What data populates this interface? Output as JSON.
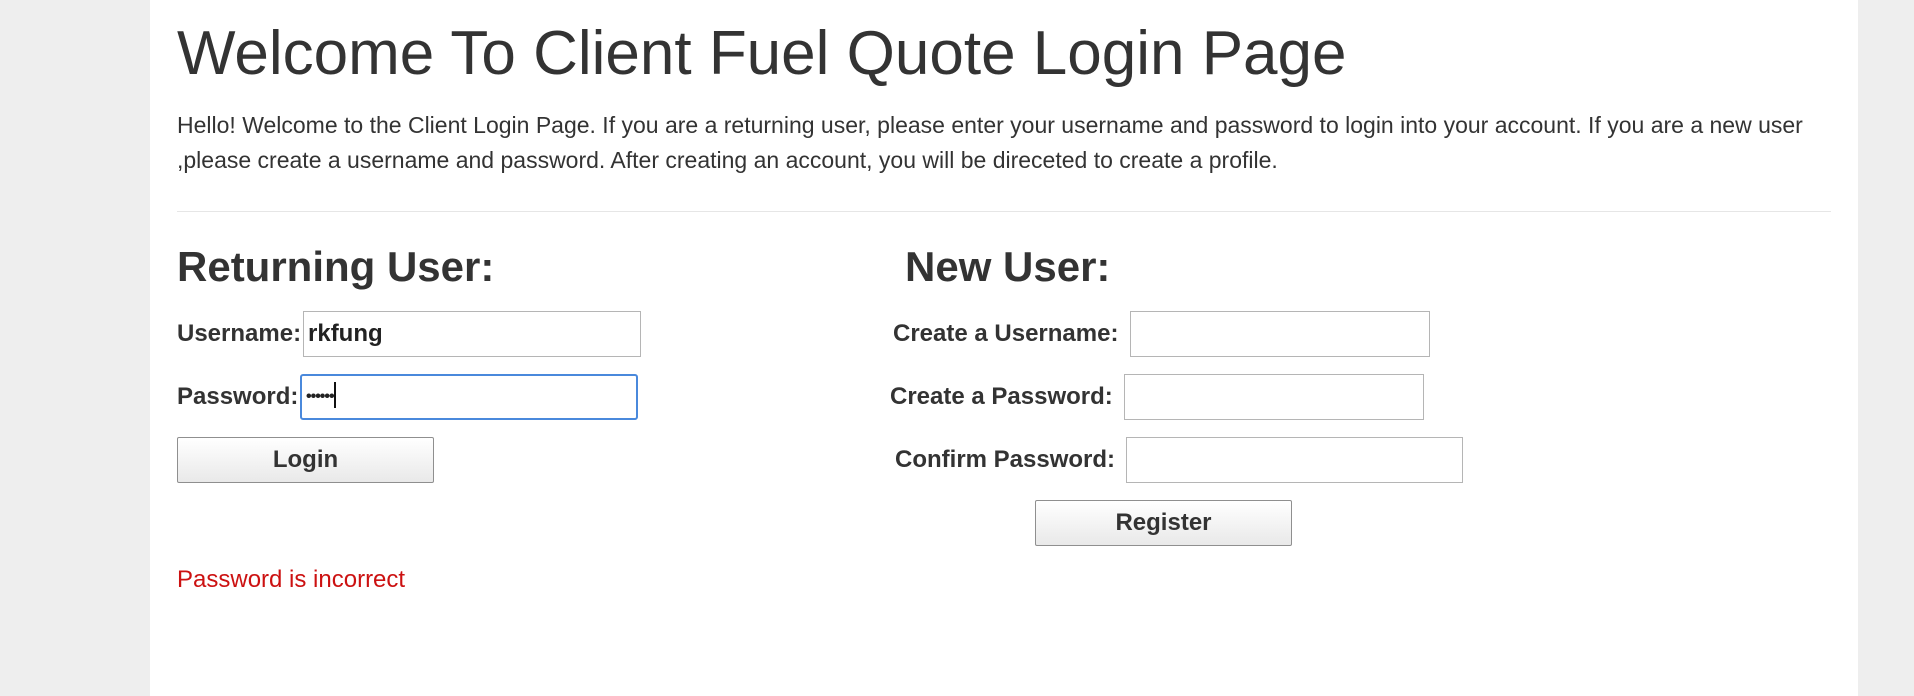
{
  "page": {
    "title": "Welcome To Client Fuel Quote Login Page",
    "intro": "Hello! Welcome to the Client Login Page. If you are a returning user, please enter your username and password to login into your account. If you are a new user ,please create a username and password. After creating an account, you will be direceted to create a profile."
  },
  "returning": {
    "heading": "Returning User:",
    "username_label": "Username:",
    "username_value": "rkfung",
    "password_label": "Password:",
    "password_mask": "••••••",
    "login_label": "Login"
  },
  "new_user": {
    "heading": "New User:",
    "create_username_label": "Create a Username:",
    "create_username_value": "",
    "create_password_label": "Create a Password:",
    "create_password_value": "",
    "confirm_password_label": "Confirm Password:",
    "confirm_password_value": "",
    "register_label": "Register"
  },
  "error": {
    "message": "Password is incorrect",
    "color": "#cc1111"
  },
  "colors": {
    "page_background": "#eeeeee",
    "content_background": "#ffffff",
    "focus_border": "#4a89dc"
  }
}
